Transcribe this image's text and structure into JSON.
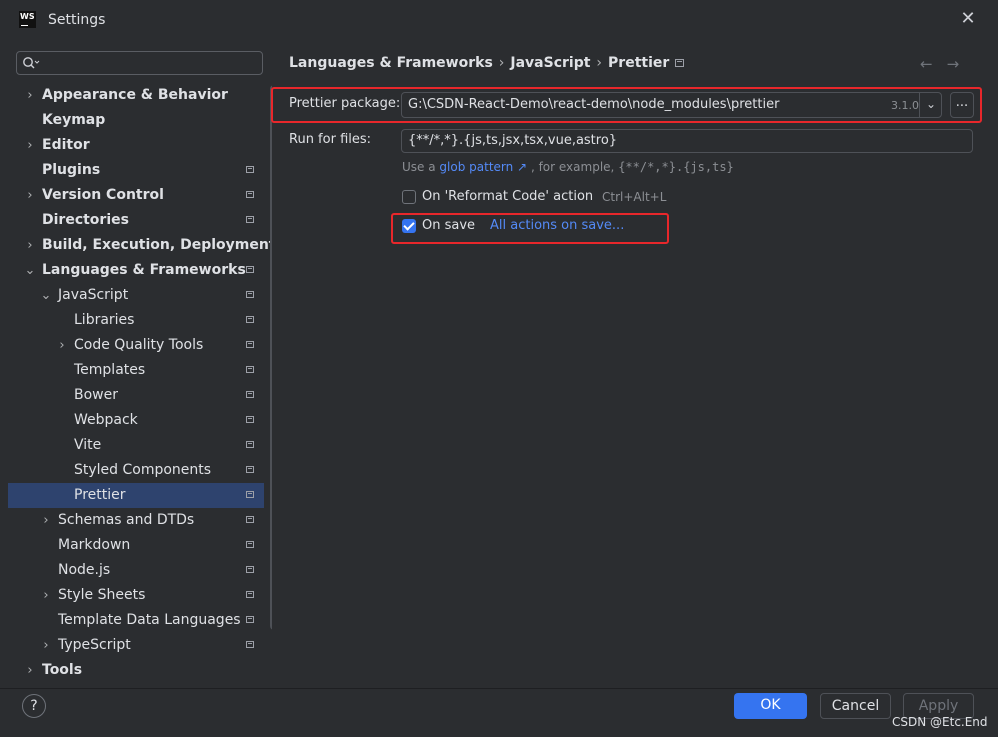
{
  "window": {
    "title": "Settings",
    "app_logo_text": "WS"
  },
  "search": {
    "placeholder": "",
    "icon": "search-icon"
  },
  "tree": [
    {
      "label": "Appearance & Behavior",
      "level": 0,
      "chevron": "›",
      "bold": true,
      "project": false
    },
    {
      "label": "Keymap",
      "level": 0,
      "chevron": "",
      "bold": true,
      "project": false
    },
    {
      "label": "Editor",
      "level": 0,
      "chevron": "›",
      "bold": true,
      "project": false
    },
    {
      "label": "Plugins",
      "level": 0,
      "chevron": "",
      "bold": true,
      "project": true
    },
    {
      "label": "Version Control",
      "level": 0,
      "chevron": "›",
      "bold": true,
      "project": true
    },
    {
      "label": "Directories",
      "level": 0,
      "chevron": "",
      "bold": true,
      "project": true
    },
    {
      "label": "Build, Execution, Deployment",
      "level": 0,
      "chevron": "›",
      "bold": true,
      "project": false
    },
    {
      "label": "Languages & Frameworks",
      "level": 0,
      "chevron": "⌄",
      "bold": true,
      "project": true
    },
    {
      "label": "JavaScript",
      "level": 1,
      "chevron": "⌄",
      "bold": false,
      "project": true
    },
    {
      "label": "Libraries",
      "level": 2,
      "chevron": "",
      "bold": false,
      "project": true
    },
    {
      "label": "Code Quality Tools",
      "level": 2,
      "chevron": "›",
      "bold": false,
      "project": true
    },
    {
      "label": "Templates",
      "level": 2,
      "chevron": "",
      "bold": false,
      "project": true
    },
    {
      "label": "Bower",
      "level": 2,
      "chevron": "",
      "bold": false,
      "project": true
    },
    {
      "label": "Webpack",
      "level": 2,
      "chevron": "",
      "bold": false,
      "project": true
    },
    {
      "label": "Vite",
      "level": 2,
      "chevron": "",
      "bold": false,
      "project": true
    },
    {
      "label": "Styled Components",
      "level": 2,
      "chevron": "",
      "bold": false,
      "project": true
    },
    {
      "label": "Prettier",
      "level": 2,
      "chevron": "",
      "bold": false,
      "project": true,
      "selected": true
    },
    {
      "label": "Schemas and DTDs",
      "level": 1,
      "chevron": "›",
      "bold": false,
      "project": true
    },
    {
      "label": "Markdown",
      "level": 1,
      "chevron": "",
      "bold": false,
      "project": true
    },
    {
      "label": "Node.js",
      "level": 1,
      "chevron": "",
      "bold": false,
      "project": true
    },
    {
      "label": "Style Sheets",
      "level": 1,
      "chevron": "›",
      "bold": false,
      "project": true
    },
    {
      "label": "Template Data Languages",
      "level": 1,
      "chevron": "",
      "bold": false,
      "project": true
    },
    {
      "label": "TypeScript",
      "level": 1,
      "chevron": "›",
      "bold": false,
      "project": true
    },
    {
      "label": "Tools",
      "level": 0,
      "chevron": "›",
      "bold": true,
      "project": false
    }
  ],
  "breadcrumb": {
    "items": [
      "Languages & Frameworks",
      "JavaScript",
      "Prettier"
    ],
    "separator": "›",
    "nav_back": "←",
    "nav_forward": "→"
  },
  "prettier_package": {
    "label": "Prettier package:",
    "value": "G:\\CSDN-React-Demo\\react-demo\\node_modules\\prettier",
    "version": "3.1.0",
    "browse_label": "..."
  },
  "run_for_files": {
    "label": "Run for files:",
    "value": "{**/*,*}.{js,ts,jsx,tsx,vue,astro}",
    "hint_prefix": "Use a",
    "hint_link": "glob pattern ↗",
    "hint_middle": ", for example,",
    "hint_example": "{**/*,*}.{js,ts}"
  },
  "reformat_option": {
    "label": "On 'Reformat Code' action",
    "shortcut": "Ctrl+Alt+L",
    "checked": false
  },
  "save_option": {
    "label": "On save",
    "checked": true,
    "link": "All actions on save..."
  },
  "footer": {
    "help": "?",
    "ok": "OK",
    "cancel": "Cancel",
    "apply": "Apply"
  },
  "watermark": "CSDN @Etc.End",
  "colors": {
    "accent": "#3574f0",
    "link": "#548af7",
    "highlight_box": "#e8272b",
    "selection": "#2e436e"
  }
}
